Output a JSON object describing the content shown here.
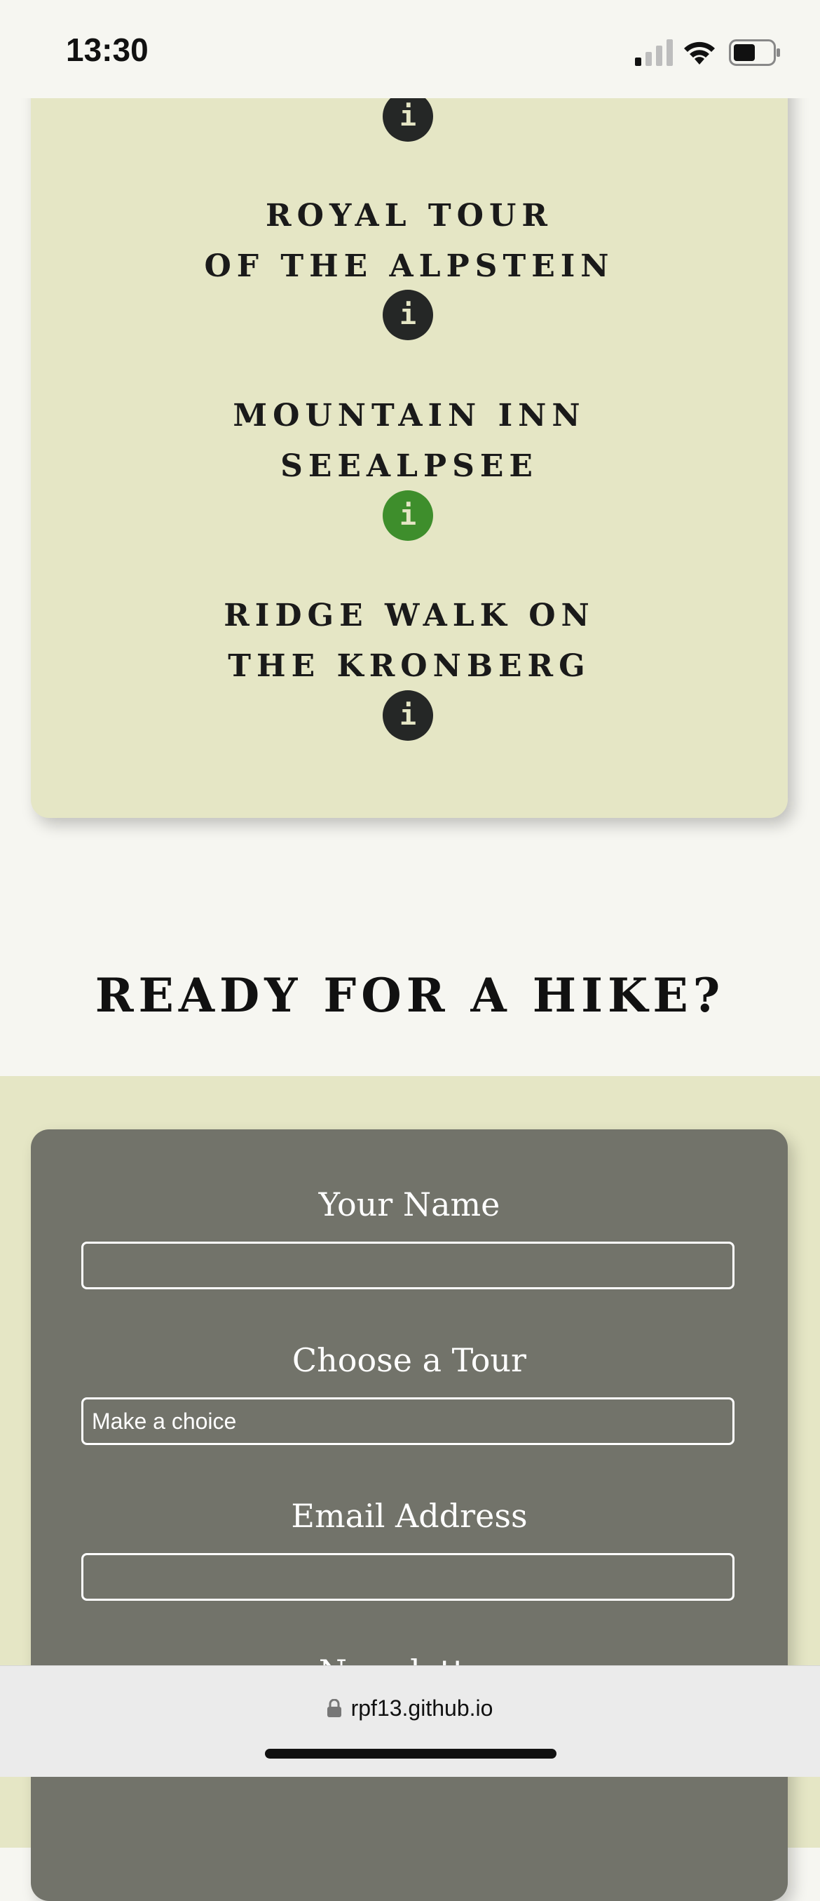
{
  "status_bar": {
    "time": "13:30"
  },
  "tours": [
    {
      "line1": "Royal Tour",
      "line2": "of the Alpstein",
      "info": "i",
      "active": false
    },
    {
      "line1": "Mountain Inn",
      "line2": "Seealpsee",
      "info": "i",
      "active": true
    },
    {
      "line1": "Ridge Walk on",
      "line2": "the Kronberg",
      "info": "i",
      "active": false
    }
  ],
  "top_info": "i",
  "heading": "Ready for a Hike?",
  "form": {
    "name_label": "Your Name",
    "name_value": "",
    "tour_label": "Choose a Tour",
    "tour_value": "Make a choice",
    "email_label": "Email Address",
    "email_value": "",
    "newsletter_label": "Newsletter"
  },
  "browser": {
    "url": "rpf13.github.io"
  },
  "colors": {
    "page_bg": "#f6f6f1",
    "card_bg": "#e5e6c5",
    "form_bg": "#72736a",
    "info_dark": "#252726",
    "info_active": "#3e8e2c"
  }
}
